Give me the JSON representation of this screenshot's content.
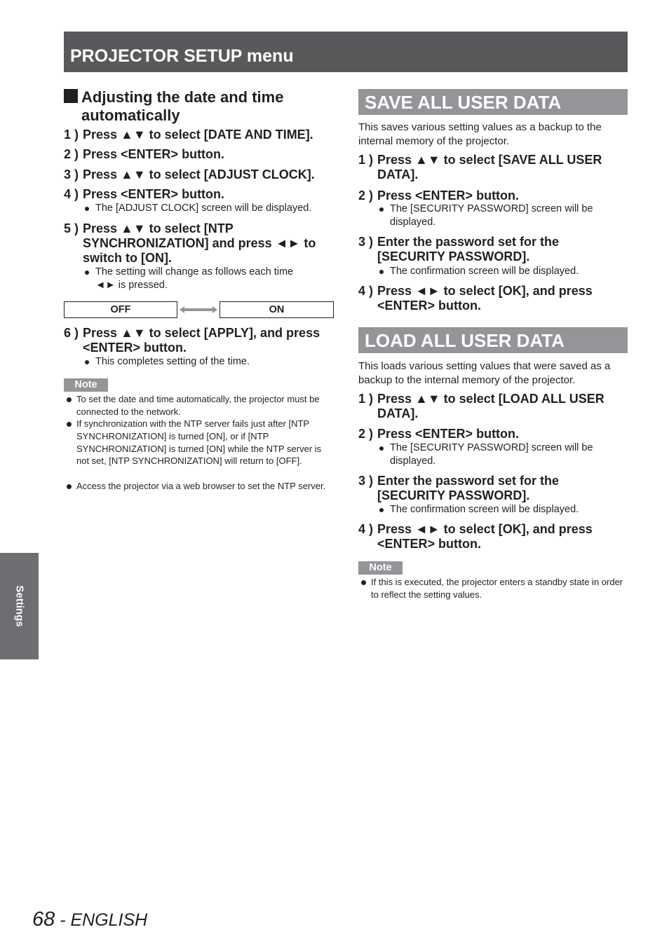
{
  "header": {
    "title": "PROJECTOR SETUP menu"
  },
  "left": {
    "subheading": "Adjusting the date and time automatically",
    "steps": [
      {
        "num": "1 )",
        "text": "Press ▲▼ to select [DATE AND TIME]."
      },
      {
        "num": "2 )",
        "text": "Press <ENTER> button."
      },
      {
        "num": "3 )",
        "text": "Press ▲▼ to select [ADJUST CLOCK]."
      },
      {
        "num": "4 )",
        "text": "Press <ENTER> button.",
        "bullet": "The [ADJUST CLOCK] screen will be displayed."
      },
      {
        "num": "5 )",
        "text": "Press ▲▼ to select [NTP SYNCHRONIZATION] and press ◄► to switch to [ON].",
        "bullet": "The setting will change as follows each time ◄► is pressed."
      },
      {
        "num": "6 )",
        "text": "Press ▲▼ to select [APPLY], and press <ENTER> button.",
        "bullet": "This completes setting of the time."
      }
    ],
    "toggle": {
      "off": "OFF",
      "on": "ON"
    },
    "note_label": "Note",
    "notes": [
      "To set the date and time automatically, the projector must be connected to the network.",
      "If synchronization with the NTP server fails just after [NTP SYNCHRONIZATION] is turned [ON], or if [NTP SYNCHRONIZATION] is turned [ON] while the NTP server is not set, [NTP SYNCHRONIZATION] will return to [OFF].",
      "Access the projector via a web browser to set the NTP server."
    ]
  },
  "save": {
    "title": "SAVE ALL USER DATA",
    "intro": "This saves various setting values as a backup to the internal memory of the projector.",
    "steps": [
      {
        "num": "1 )",
        "text": "Press ▲▼ to select [SAVE ALL USER DATA]."
      },
      {
        "num": "2 )",
        "text": "Press <ENTER> button.",
        "bullet": "The [SECURITY PASSWORD] screen will be displayed."
      },
      {
        "num": "3 )",
        "text": "Enter the password set for the [SECURITY PASSWORD].",
        "bullet": "The confirmation screen will be displayed."
      },
      {
        "num": "4 )",
        "text": "Press ◄► to select [OK], and press <ENTER> button."
      }
    ]
  },
  "load": {
    "title": "LOAD ALL USER DATA",
    "intro": "This loads various setting values that were saved as a backup to the internal memory of the projector.",
    "steps": [
      {
        "num": "1 )",
        "text": "Press ▲▼ to select [LOAD ALL USER DATA]."
      },
      {
        "num": "2 )",
        "text": "Press <ENTER> button.",
        "bullet": "The [SECURITY PASSWORD] screen will be displayed."
      },
      {
        "num": "3 )",
        "text": "Enter the password set for the [SECURITY PASSWORD].",
        "bullet": "The confirmation screen will be displayed."
      },
      {
        "num": "4 )",
        "text": "Press ◄► to select [OK], and press <ENTER> button."
      }
    ],
    "note_label": "Note",
    "notes": [
      "If this is executed, the projector enters a standby state in order to reflect the setting values."
    ]
  },
  "side_tab": {
    "label": "Settings"
  },
  "footer": {
    "page_number": "68",
    "language": " - ENGLISH"
  }
}
